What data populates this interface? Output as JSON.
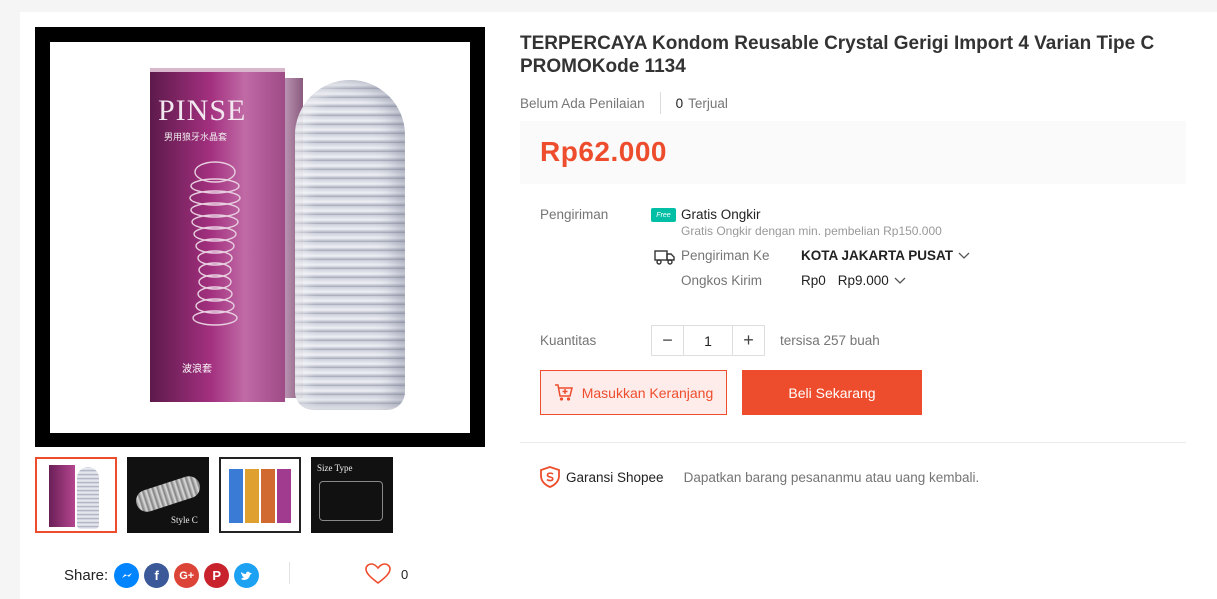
{
  "product": {
    "title": "TERPERCAYA Kondom Reusable Crystal Gerigi Import 4 Varian Tipe C PROMOKode 1134",
    "rating_text": "Belum Ada Penilaian",
    "sold_count": "0",
    "sold_label": "Terjual",
    "price": "Rp62.000",
    "image_brand": "PINSE",
    "image_subtitle": "男用狼牙水晶套",
    "image_caption": "波浪套"
  },
  "thumbnails": [
    {
      "label": ""
    },
    {
      "label": "Style C"
    },
    {
      "label": ""
    },
    {
      "label": "Size Type"
    }
  ],
  "shipping": {
    "label": "Pengiriman",
    "free_badge": "Free",
    "free_title": "Gratis Ongkir",
    "free_note": "Gratis Ongkir dengan min. pembelian Rp150.000",
    "to_label": "Pengiriman Ke",
    "to_value": "KOTA JAKARTA PUSAT",
    "cost_label": "Ongkos Kirim",
    "cost_min": "Rp0",
    "cost_max": "Rp9.000"
  },
  "quantity": {
    "label": "Kuantitas",
    "value": "1",
    "minus": "−",
    "plus": "+",
    "stock_text": "tersisa 257 buah"
  },
  "actions": {
    "add_to_cart": "Masukkan Keranjang",
    "buy_now": "Beli Sekarang"
  },
  "guarantee": {
    "title": "Garansi Shopee",
    "desc": "Dapatkan barang pesananmu atau uang kembali."
  },
  "share": {
    "label": "Share:",
    "favorite_count": "0"
  },
  "colors": {
    "accent": "#ee4d2d",
    "messenger": "#0084ff",
    "facebook": "#3b5998",
    "google_plus": "#db4437",
    "pinterest": "#c8232c",
    "twitter": "#1da1f2"
  }
}
